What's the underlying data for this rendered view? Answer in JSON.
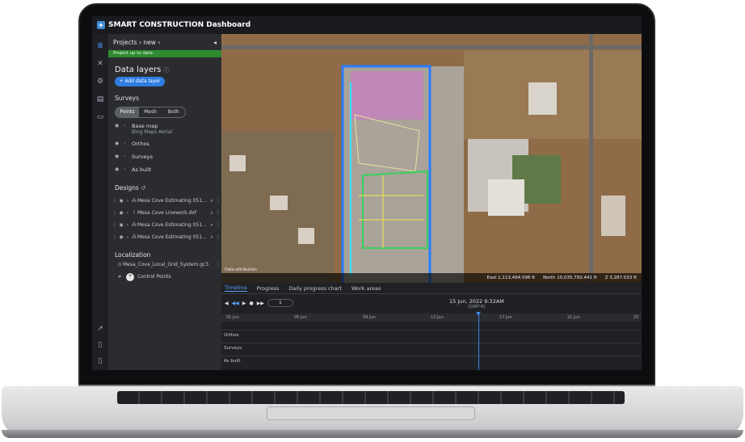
{
  "app": {
    "title": "SMART CONSTRUCTION Dashboard"
  },
  "project": {
    "breadcrumb": "Projects › new ‹",
    "status": "Project up to date"
  },
  "data_layers": {
    "title": "Data layers",
    "add_button": "+ Add data layer",
    "surveys_title": "Surveys",
    "view_modes": [
      "Points",
      "Mesh",
      "Both"
    ],
    "active_view_mode": "Points",
    "layers": [
      {
        "name": "Base map",
        "sub": "Bing Maps Aerial"
      },
      {
        "name": "Orthos",
        "sub": ""
      },
      {
        "name": "Surveys",
        "sub": ""
      },
      {
        "name": "As built",
        "sub": ""
      }
    ]
  },
  "designs": {
    "title": "Designs",
    "items": [
      "Mesa Cove Estimating 051...",
      "Mesa Cove Linework.dxf",
      "Mesa Cove Estimating 051...",
      "Mesa Cove Estimating 051..."
    ]
  },
  "localization": {
    "title": "Localization",
    "file": "Mesa_Cove_Local_Grid_System.gc3",
    "control_points": "Control Points"
  },
  "map": {
    "attribution": "Data attribution",
    "coords": {
      "east": "East 1,113,494.596 ft",
      "north": "North 10,035,792.441 ft",
      "z": "Z 3,287.033 ft"
    }
  },
  "timeline": {
    "tabs": [
      "Timeline",
      "Progress",
      "Daily progress chart",
      "Work areas"
    ],
    "active_tab": "Timeline",
    "step": "1",
    "date": "15 Jun, 2022 9:32AM",
    "tz": "(GMT-6)",
    "ticks": [
      "01 Jun",
      "05 Jun",
      "09 Jun",
      "13 Jun",
      "17 Jun",
      "21 Jun",
      "25"
    ],
    "rows": [
      "Orthos",
      "Surveys",
      "As built"
    ]
  }
}
